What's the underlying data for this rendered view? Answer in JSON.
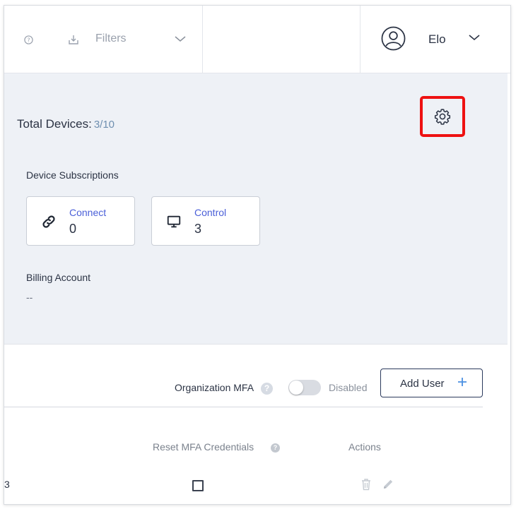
{
  "header": {
    "filters_label": "Filters",
    "user_name": "Elo"
  },
  "devices": {
    "total_label": "Total Devices:",
    "total_count": "3/10",
    "subscriptions_title": "Device Subscriptions",
    "subscriptions": [
      {
        "label": "Connect",
        "value": "0",
        "icon": "link-icon"
      },
      {
        "label": "Control",
        "value": "3",
        "icon": "monitor-icon"
      }
    ],
    "billing_title": "Billing Account",
    "billing_value": "--"
  },
  "users": {
    "mfa_label": "Organization MFA",
    "mfa_status": "Disabled",
    "add_user_label": "Add User",
    "columns": {
      "reset_mfa": "Reset MFA Credentials",
      "actions": "Actions"
    },
    "row_first_cell": "3"
  },
  "colors": {
    "panel_bg": "#eef1f6",
    "accent_link": "#4a5fd8",
    "highlight_box": "#ee1111",
    "add_plus": "#4a90e2"
  }
}
